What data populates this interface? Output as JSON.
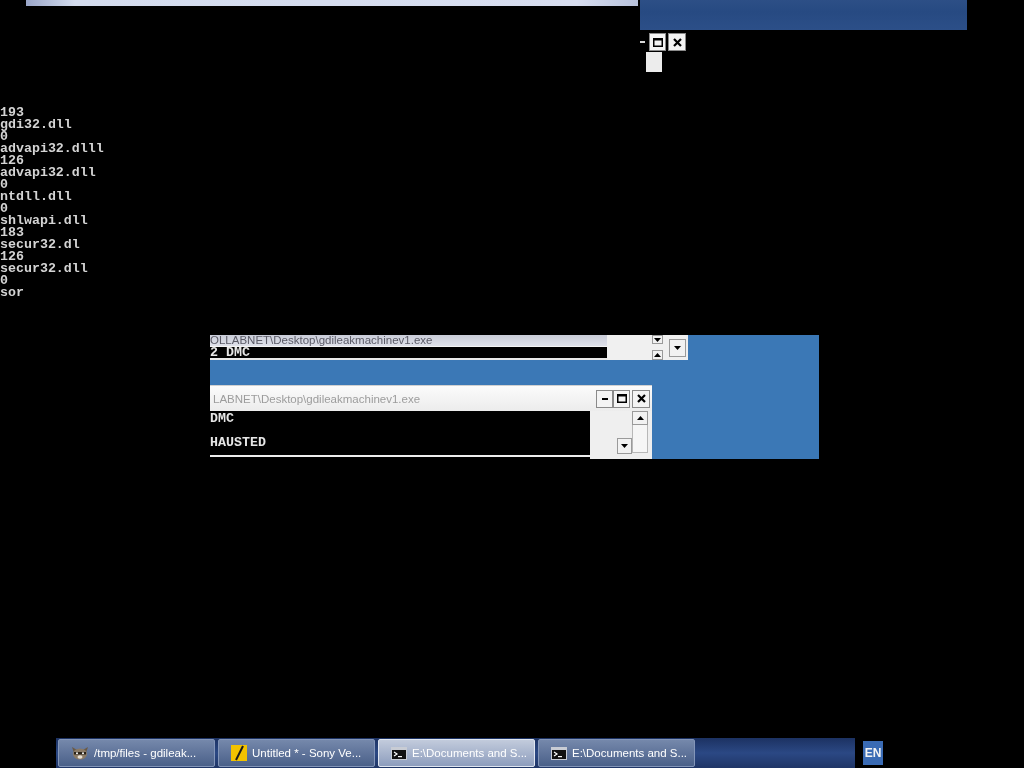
{
  "console": {
    "lines": [
      "193",
      "gdi32.dll",
      "0",
      "advapi32.dlll",
      "126",
      "advapi32.dll",
      "0",
      "ntdll.dll",
      "0",
      "shlwapi.dll",
      "183",
      "secur32.dl",
      "126",
      "secur32.dll",
      "0",
      "sor"
    ]
  },
  "back_window": {
    "title": "OLLABNET\\Desktop\\gdileakmachinev1.exe",
    "lines": [
      "2 DMC"
    ]
  },
  "front_window": {
    "title": "LABNET\\Desktop\\gdileakmachinev1.exe",
    "lines": [
      "DMC",
      "HAUSTED"
    ]
  },
  "taskbar": {
    "buttons": [
      {
        "kind": "file-manager",
        "label": "/tmp/files - gdileak...",
        "selected": false
      },
      {
        "kind": "video-editor",
        "label": "Untitled * - Sony Ve...",
        "selected": false
      },
      {
        "kind": "console",
        "label": "E:\\Documents and S...",
        "selected": true
      },
      {
        "kind": "console",
        "label": "E:\\Documents and S...",
        "selected": false
      }
    ],
    "language": "EN"
  }
}
